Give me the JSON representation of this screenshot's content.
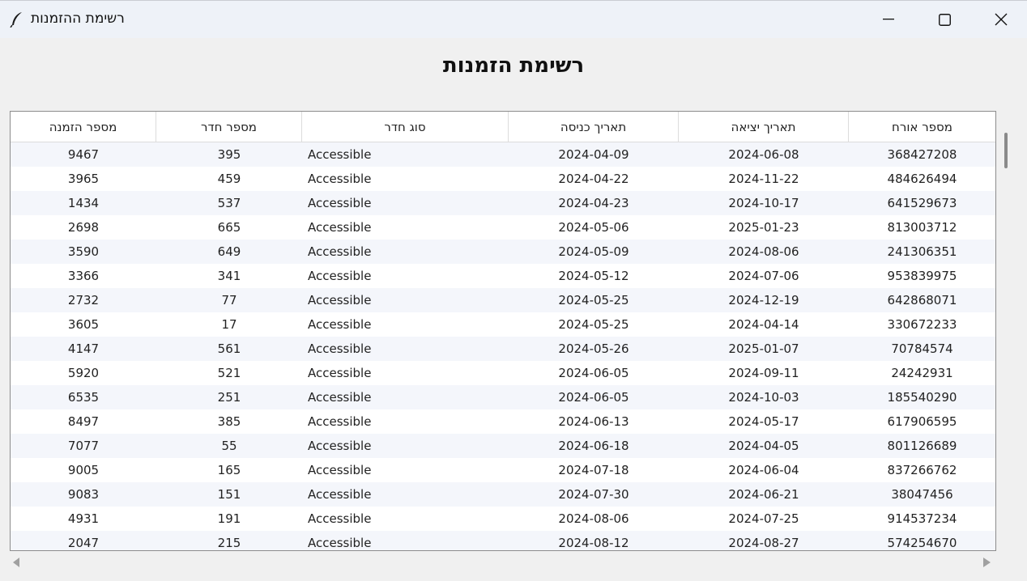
{
  "window": {
    "title": "רשימת ההזמנות",
    "icon": "feather-icon"
  },
  "heading": "רשימת הזמנות",
  "table": {
    "columns": [
      "מספר הזמנה",
      "מספר חדר",
      "סוג חדר",
      "תאריך כניסה",
      "תאריך יציאה",
      "מספר אורח"
    ],
    "rows": [
      [
        "9467",
        "395",
        "Accessible",
        "2024-04-09",
        "2024-06-08",
        "368427208"
      ],
      [
        "3965",
        "459",
        "Accessible",
        "2024-04-22",
        "2024-11-22",
        "484626494"
      ],
      [
        "1434",
        "537",
        "Accessible",
        "2024-04-23",
        "2024-10-17",
        "641529673"
      ],
      [
        "2698",
        "665",
        "Accessible",
        "2024-05-06",
        "2025-01-23",
        "813003712"
      ],
      [
        "3590",
        "649",
        "Accessible",
        "2024-05-09",
        "2024-08-06",
        "241306351"
      ],
      [
        "3366",
        "341",
        "Accessible",
        "2024-05-12",
        "2024-07-06",
        "953839975"
      ],
      [
        "2732",
        "77",
        "Accessible",
        "2024-05-25",
        "2024-12-19",
        "642868071"
      ],
      [
        "3605",
        "17",
        "Accessible",
        "2024-05-25",
        "2024-04-14",
        "330672233"
      ],
      [
        "4147",
        "561",
        "Accessible",
        "2024-05-26",
        "2025-01-07",
        "70784574"
      ],
      [
        "5920",
        "521",
        "Accessible",
        "2024-06-05",
        "2024-09-11",
        "24242931"
      ],
      [
        "6535",
        "251",
        "Accessible",
        "2024-06-05",
        "2024-10-03",
        "185540290"
      ],
      [
        "8497",
        "385",
        "Accessible",
        "2024-06-13",
        "2024-05-17",
        "617906595"
      ],
      [
        "7077",
        "55",
        "Accessible",
        "2024-06-18",
        "2024-04-05",
        "801126689"
      ],
      [
        "9005",
        "165",
        "Accessible",
        "2024-07-18",
        "2024-06-04",
        "837266762"
      ],
      [
        "9083",
        "151",
        "Accessible",
        "2024-07-30",
        "2024-06-21",
        "38047456"
      ],
      [
        "4931",
        "191",
        "Accessible",
        "2024-08-06",
        "2024-07-25",
        "914537234"
      ],
      [
        "2047",
        "215",
        "Accessible",
        "2024-08-12",
        "2024-08-27",
        "574254670"
      ]
    ]
  },
  "colors": {
    "titlebar": "#eef2f8",
    "row_alt": "#f4f6fb",
    "background": "#f0f0f0"
  }
}
